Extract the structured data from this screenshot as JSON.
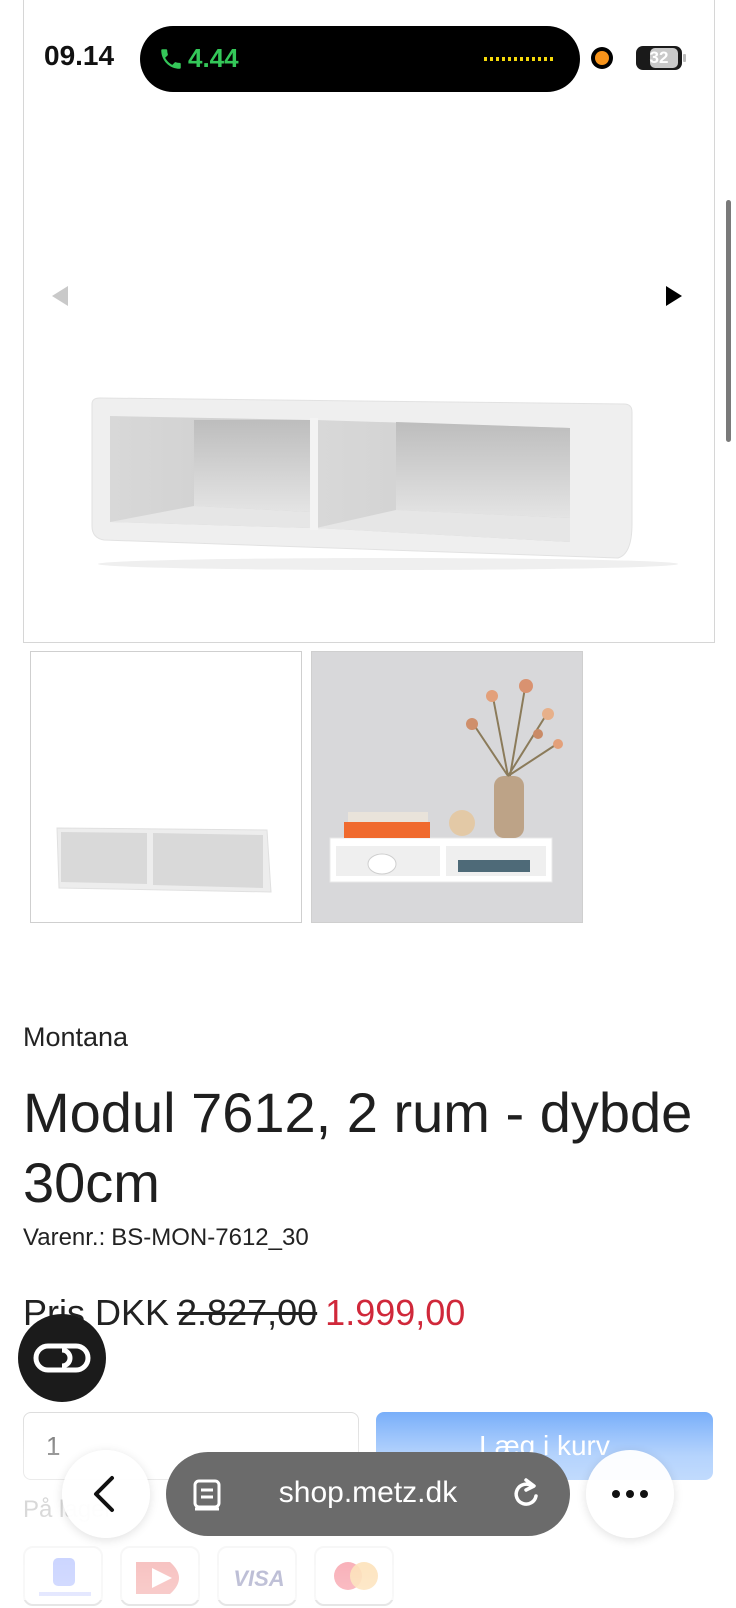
{
  "status_bar": {
    "time": "09.14",
    "call_duration": "4.44",
    "battery": "32"
  },
  "gallery": {
    "prev_icon": "triangle-left-icon",
    "next_icon": "triangle-right-icon",
    "thumbnails": [
      "shelf-product-photo",
      "shelf-lifestyle-photo"
    ]
  },
  "product": {
    "brand": "Montana",
    "title": "Modul 7612, 2 rum - dybde 30cm",
    "sku_label": "Varenr.:",
    "sku_value": "BS-MON-7612_30",
    "price_label": "Pris DKK",
    "old_price": "2.827,00",
    "new_price": "1.999,00",
    "old_price_color": "#222222",
    "new_price_color": "#d0283a"
  },
  "cart": {
    "quantity": "1",
    "add_to_cart_label": "Læg i kurv",
    "button_color": "#3f8cf7"
  },
  "payment": {
    "label": "På lager",
    "methods": [
      "mobilepay",
      "dankort",
      "VISA",
      "mastercard"
    ]
  },
  "chat": {
    "icon": "chat-bubble-icon"
  },
  "browser": {
    "url": "shop.metz.dk",
    "back_icon": "chevron-left-icon",
    "reader_icon": "reader-icon",
    "reload_icon": "reload-icon",
    "more_icon": "ellipsis-icon"
  }
}
